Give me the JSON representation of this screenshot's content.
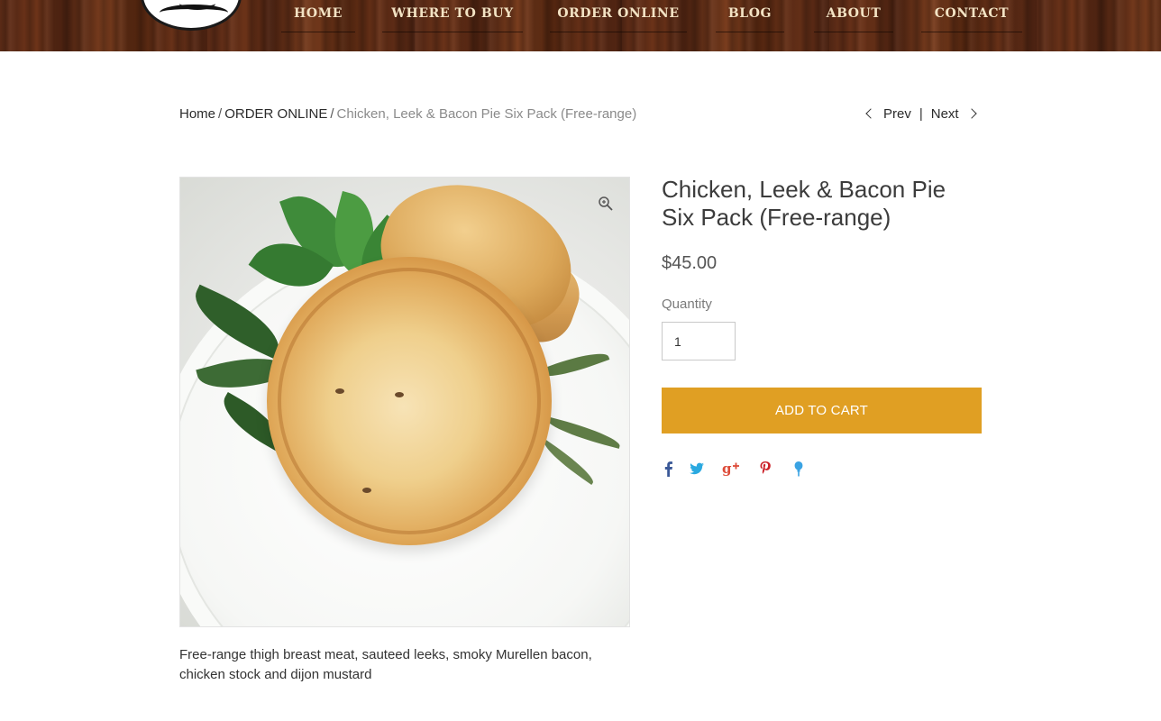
{
  "header": {
    "nav": [
      {
        "label": "HOME"
      },
      {
        "label": "WHERE TO BUY"
      },
      {
        "label": "ORDER ONLINE"
      },
      {
        "label": "BLOG"
      },
      {
        "label": "ABOUT"
      },
      {
        "label": "CONTACT"
      }
    ]
  },
  "breadcrumb": {
    "home": "Home",
    "separator": "/",
    "category": "ORDER ONLINE",
    "current": "Chicken, Leek & Bacon Pie Six Pack (Free-range)"
  },
  "pager": {
    "prev": "Prev",
    "divider": "|",
    "next": "Next"
  },
  "product": {
    "title": "Chicken, Leek & Bacon Pie Six Pack (Free-range)",
    "price": "$45.00",
    "quantity_label": "Quantity",
    "quantity_value": "1",
    "add_to_cart": "Add to Cart",
    "description": "Free-range thigh breast meat, sauteed leeks, smoky Murellen bacon, chicken stock and dijon mustard",
    "accent_color": "#e09f23"
  },
  "share": {
    "icons": [
      "facebook-icon",
      "twitter-icon",
      "google-plus-icon",
      "pinterest-icon",
      "fancy-icon"
    ],
    "colors": {
      "facebook": "#3b5998",
      "twitter": "#2aa9e0",
      "google_plus": "#dd4b39",
      "pinterest": "#cb2027",
      "fancy": "#3aa3e3"
    }
  }
}
